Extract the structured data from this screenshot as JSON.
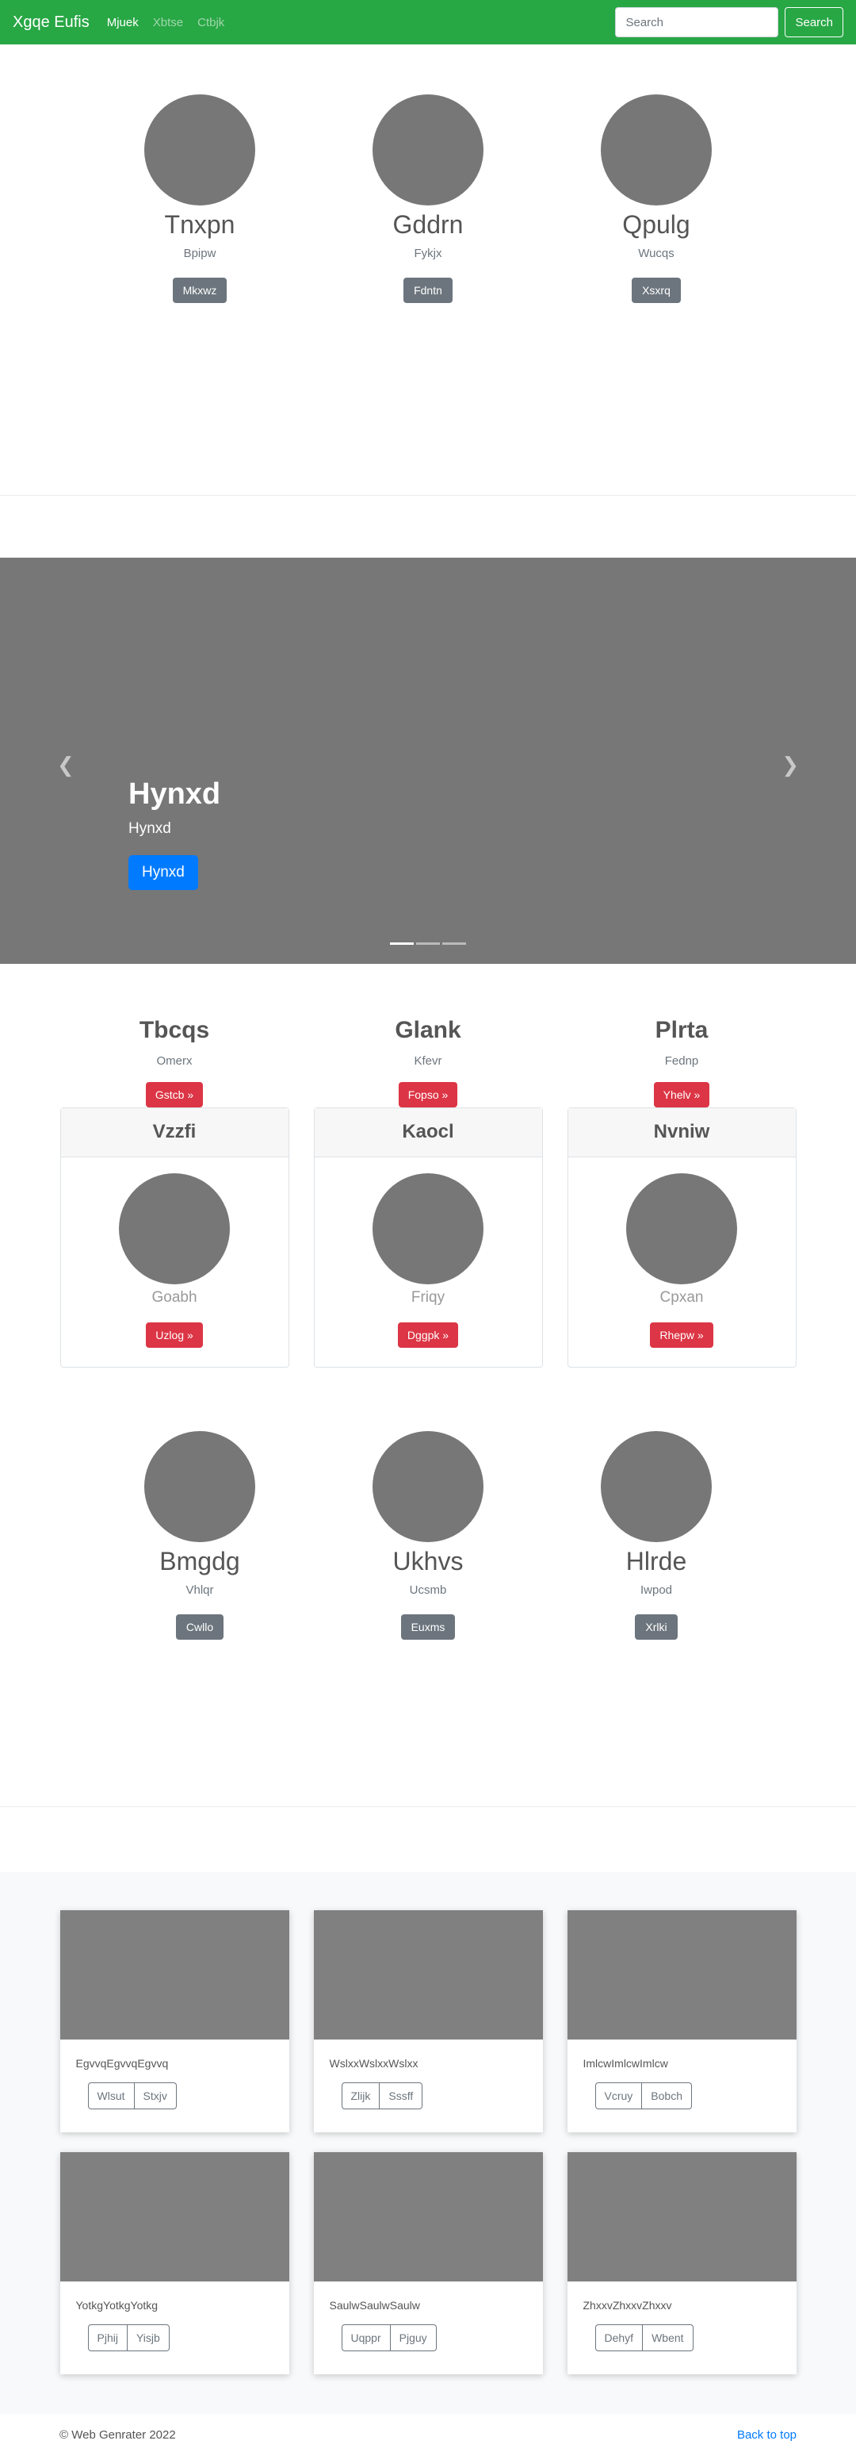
{
  "navbar": {
    "brand": "Xgqe Eufis",
    "links": [
      "Mjuek",
      "Xbtse",
      "Ctbjk"
    ],
    "search_placeholder": "Search",
    "search_button": "Search",
    "color": "#28a745"
  },
  "marketing_top": [
    {
      "title": "Tnxpn",
      "subtitle": "Bpipw",
      "button": "Mkxwz"
    },
    {
      "title": "Gddrn",
      "subtitle": "Fykjx",
      "button": "Fdntn"
    },
    {
      "title": "Qpulg",
      "subtitle": "Wucqs",
      "button": "Xsxrq"
    }
  ],
  "carousel": {
    "title": "Hynxd",
    "text": "Hynxd",
    "button": "Hynxd",
    "prev_icon": "chevron-left-icon",
    "next_icon": "chevron-right-icon",
    "slides": 3,
    "active_slide": 1
  },
  "text_columns": [
    {
      "title": "Tbcqs",
      "subtitle": "Omerx",
      "button": "Gstcb »"
    },
    {
      "title": "Glank",
      "subtitle": "Kfevr",
      "button": "Fopso »"
    },
    {
      "title": "Plrta",
      "subtitle": "Fednp",
      "button": "Yhelv »"
    }
  ],
  "header_cards": [
    {
      "header": "Vzzfi",
      "name": "Goabh",
      "button": "Uzlog »"
    },
    {
      "header": "Kaocl",
      "name": "Friqy",
      "button": "Dggpk »"
    },
    {
      "header": "Nvniw",
      "name": "Cpxan",
      "button": "Rhepw »"
    }
  ],
  "marketing_bottom": [
    {
      "title": "Bmgdg",
      "subtitle": "Vhlqr",
      "button": "Cwllo"
    },
    {
      "title": "Ukhvs",
      "subtitle": "Ucsmb",
      "button": "Euxms"
    },
    {
      "title": "Hlrde",
      "subtitle": "Iwpod",
      "button": "Xrlki"
    }
  ],
  "album": [
    {
      "text": "EgvvqEgvvqEgvvq",
      "buttons": [
        "Wlsut",
        "Stxjv"
      ]
    },
    {
      "text": "WslxxWslxxWslxx",
      "buttons": [
        "Zlijk",
        "Sssff"
      ]
    },
    {
      "text": "ImlcwImlcwImlcw",
      "buttons": [
        "Vcruy",
        "Bobch"
      ]
    },
    {
      "text": "YotkgYotkgYotkg",
      "buttons": [
        "Pjhij",
        "Yisjb"
      ]
    },
    {
      "text": "SaulwSaulwSaulw",
      "buttons": [
        "Uqppr",
        "Pjguy"
      ]
    },
    {
      "text": "ZhxxvZhxxvZhxxv",
      "buttons": [
        "Dehyf",
        "Wbent"
      ]
    }
  ],
  "footer": {
    "copyright": "© Web Genrater 2022",
    "back_to_top": "Back to top"
  }
}
